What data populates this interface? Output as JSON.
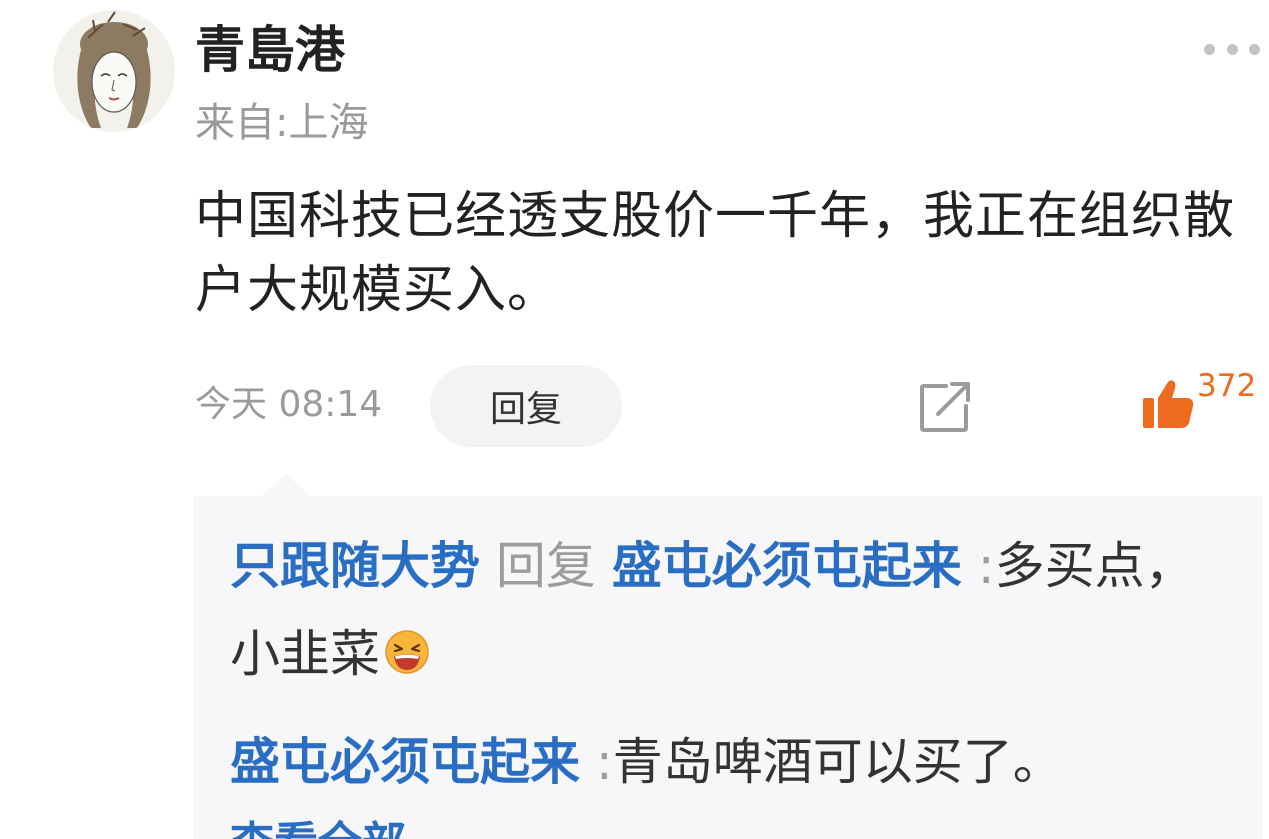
{
  "comment": {
    "username": "青島港",
    "location": "来自:上海",
    "content": "中国科技已经透支股价一千年，我正在组织散户大规模买入。",
    "time": "今天 08:14",
    "reply_label": "回复",
    "like_count": "372",
    "colors": {
      "link": "#2a6ec4",
      "like": "#ee6a1e",
      "muted": "#9a9a9a"
    }
  },
  "replies": [
    {
      "author": "只跟随大势",
      "reply_word": "回复",
      "reply_to": "盛屯必须屯起来",
      "separator": ":",
      "text": "多买点，小韭菜",
      "emoji": "laughing-emoji-icon"
    },
    {
      "author": "盛屯必须屯起来",
      "separator": ":",
      "text": "青岛啤酒可以买了。"
    }
  ],
  "more_replies_label": "查看全部"
}
